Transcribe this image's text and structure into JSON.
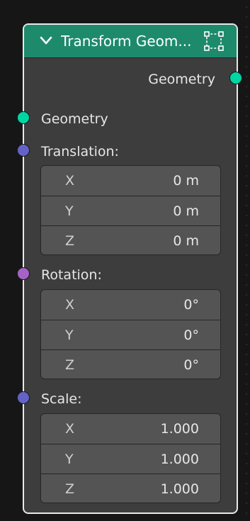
{
  "node": {
    "title": "Transform Geom...",
    "header_color": "#1e8a6c",
    "collapse_icon": "chevron-down-icon",
    "preview_icon": "bounding-box-icon",
    "output": {
      "label": "Geometry",
      "socket_color": "#00d6a3"
    },
    "inputs": {
      "geometry": {
        "label": "Geometry",
        "socket_color": "#00d6a3"
      },
      "translation": {
        "label": "Translation:",
        "socket_color": "#6363c7",
        "fields": [
          {
            "axis": "X",
            "value": "0 m"
          },
          {
            "axis": "Y",
            "value": "0 m"
          },
          {
            "axis": "Z",
            "value": "0 m"
          }
        ]
      },
      "rotation": {
        "label": "Rotation:",
        "socket_color": "#a663c7",
        "fields": [
          {
            "axis": "X",
            "value": "0°"
          },
          {
            "axis": "Y",
            "value": "0°"
          },
          {
            "axis": "Z",
            "value": "0°"
          }
        ]
      },
      "scale": {
        "label": "Scale:",
        "socket_color": "#6363c7",
        "fields": [
          {
            "axis": "X",
            "value": "1.000"
          },
          {
            "axis": "Y",
            "value": "1.000"
          },
          {
            "axis": "Z",
            "value": "1.000"
          }
        ]
      }
    }
  }
}
